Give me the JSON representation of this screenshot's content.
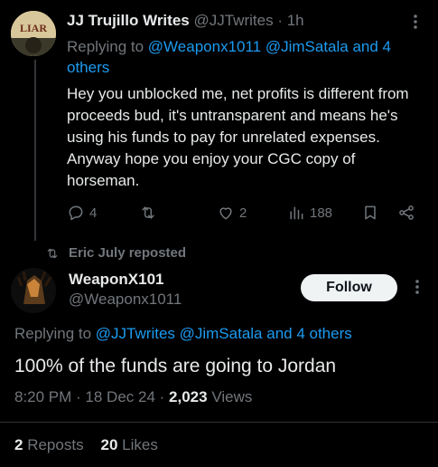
{
  "reply_tweet": {
    "author_name": "JJ Trujillo Writes",
    "author_handle": "@JJTwrites",
    "separator": "·",
    "time_ago": "1h",
    "replying_prefix": "Replying to",
    "replying_mentions": "@Weaponx1011 @JimSatala and 4 others",
    "body": "Hey you unblocked me, net profits is different from proceeds bud, it's untransparent and means he's using his funds to pay for unrelated expenses. Anyway hope you enjoy your CGC copy of horseman.",
    "actions": {
      "replies": "4",
      "retweets": "",
      "likes": "2",
      "views": "188"
    },
    "avatar_text": "LIAR"
  },
  "repost_banner": {
    "text": "Eric July reposted"
  },
  "main_tweet": {
    "author_name": "WeaponX101",
    "author_handle": "@Weaponx1011",
    "follow_label": "Follow",
    "replying_prefix": "Replying to",
    "replying_mentions": "@JJTwrites @JimSatala and 4 others",
    "body": "100% of the funds are going to Jordan",
    "time": "8:20 PM · 18 Dec 24 ·",
    "views_count": "2,023",
    "views_label": "Views",
    "reposts_count": "2",
    "reposts_label": "Reposts",
    "likes_count": "20",
    "likes_label": "Likes"
  },
  "colors": {
    "background": "#000000",
    "text": "#e7e9ea",
    "muted": "#71767b",
    "link": "#1d9bf0",
    "follow_bg": "#eff3f4"
  }
}
